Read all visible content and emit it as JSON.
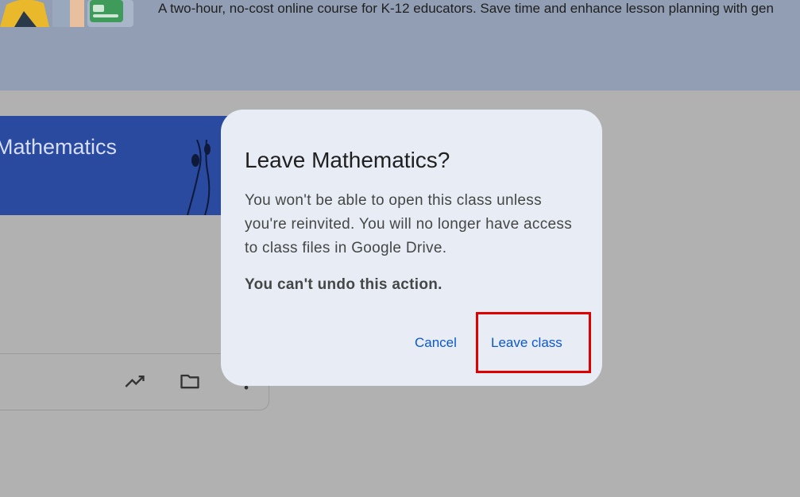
{
  "banner": {
    "text": "A two-hour, no-cost online course for K-12 educators. Save time and enhance lesson planning with gen"
  },
  "class_header": {
    "title": "Mathematics"
  },
  "card": {
    "icons": [
      "trending-up-icon",
      "folder-icon",
      "more-vert-icon"
    ]
  },
  "dialog": {
    "title": "Leave Mathematics?",
    "body": "You won't be able to open this class unless you're reinvited. You will no longer have access to class files in Google Drive.",
    "warning": "You can't undo this action.",
    "cancel_label": "Cancel",
    "confirm_label": "Leave class"
  },
  "colors": {
    "scrim": "#b1b1b1",
    "banner": "#919eb3",
    "class_header": "#2a4aa0",
    "dialog_bg": "#e8edf5",
    "accent": "#0b57d0",
    "highlight": "#e00000"
  }
}
